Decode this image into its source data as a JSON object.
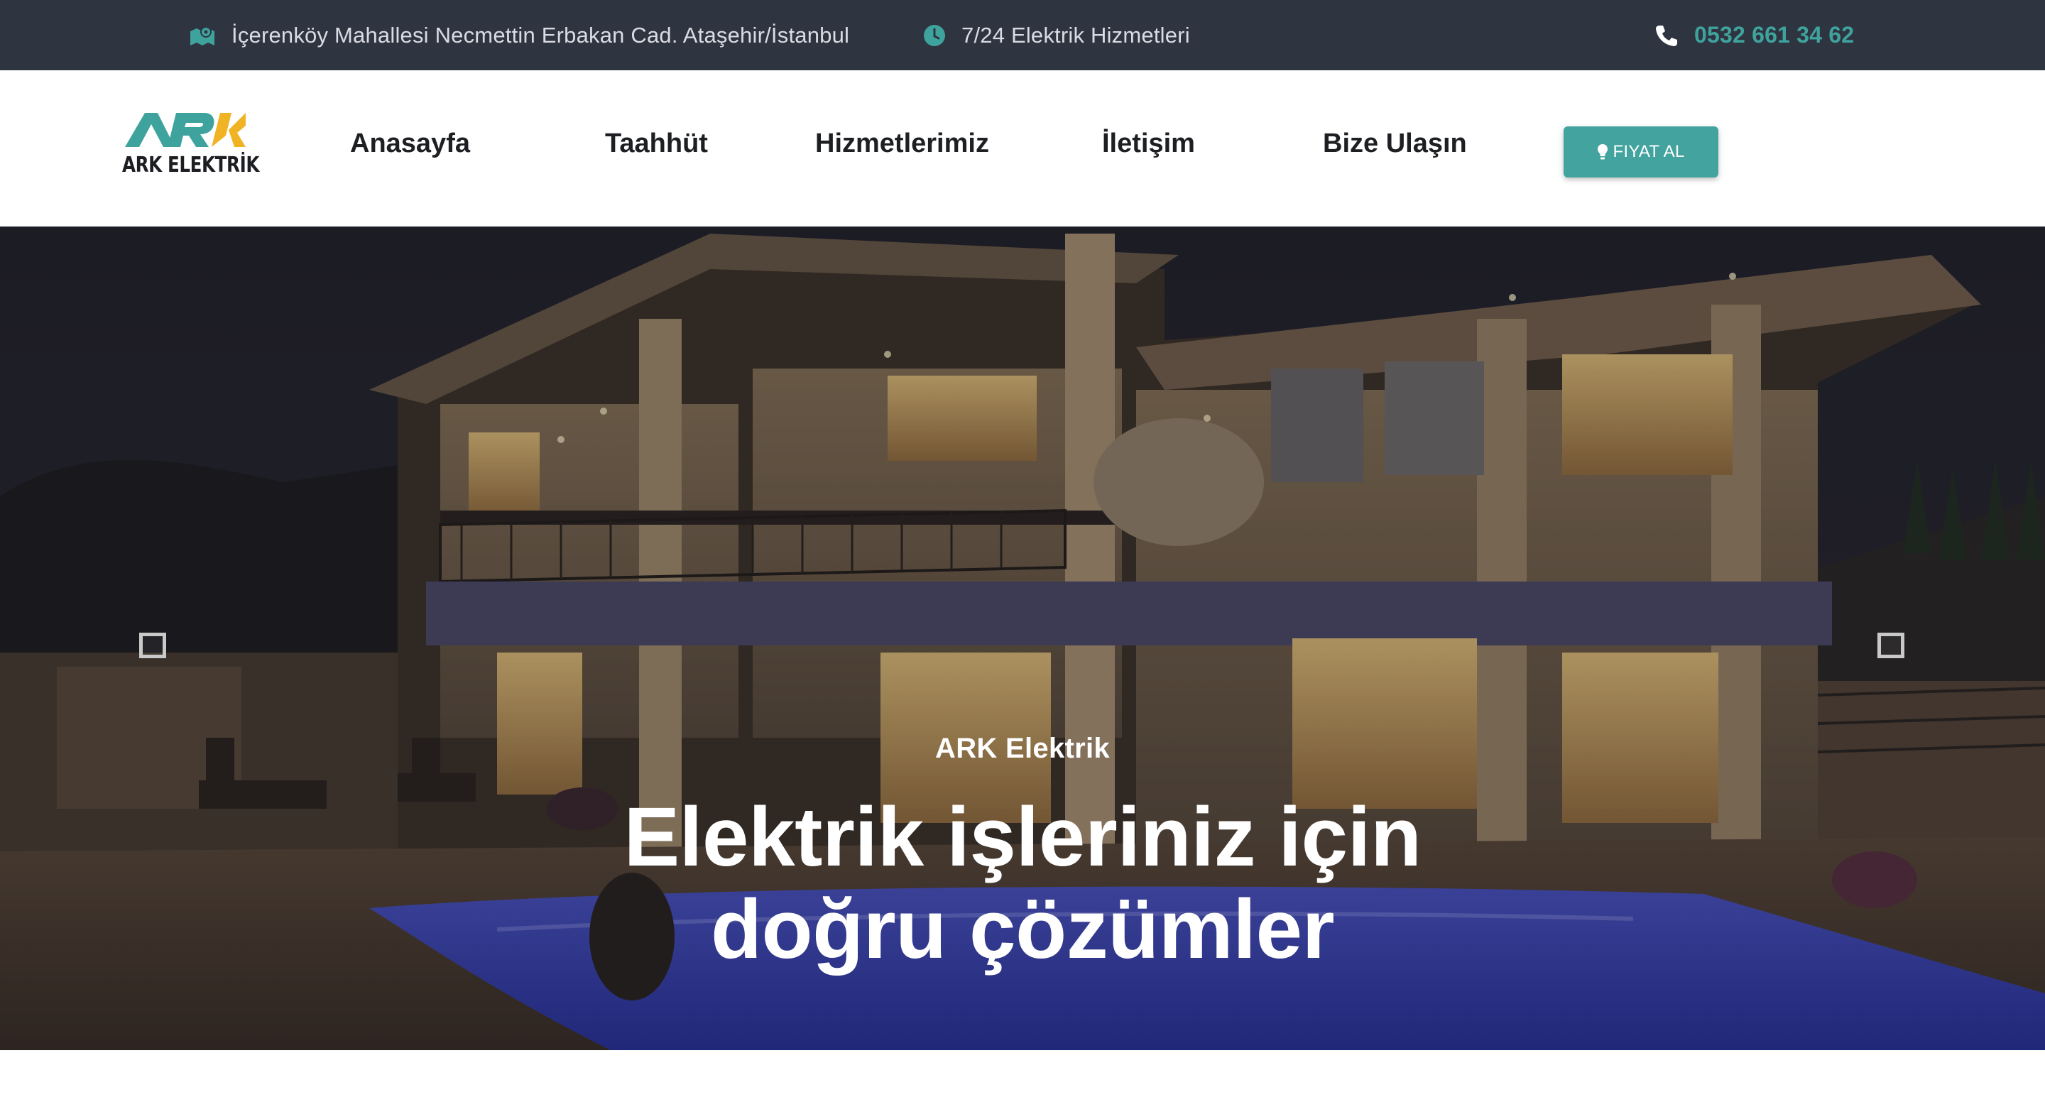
{
  "topbar": {
    "address": "İçerenköy Mahallesi Necmettin Erbakan Cad. Ataşehir/İstanbul",
    "hours": "7/24 Elektrik Hizmetleri",
    "phone": "0532 661 34 62",
    "icons": {
      "address": "map-icon",
      "hours": "clock-icon",
      "phone": "phone-icon"
    },
    "accent_color": "#3fa39d",
    "background_color": "#2f3441"
  },
  "header": {
    "logo_text": "ARK ELEKTRİK",
    "nav": [
      {
        "label": "Anasayfa"
      },
      {
        "label": "Taahhüt"
      },
      {
        "label": "Hizmetlerimiz"
      },
      {
        "label": "İletişim"
      },
      {
        "label": "Bize Ulaşın"
      }
    ],
    "cta_label": "FIYAT AL",
    "cta_icon": "lightbulb-icon",
    "cta_color": "#43a39f"
  },
  "hero": {
    "subtitle": "ARK Elektrik",
    "title_line1": "Elektrik işleriniz için",
    "title_line2": "doğru çözümler",
    "arrows": {
      "prev": "prev-arrow-icon",
      "next": "next-arrow-icon"
    }
  }
}
